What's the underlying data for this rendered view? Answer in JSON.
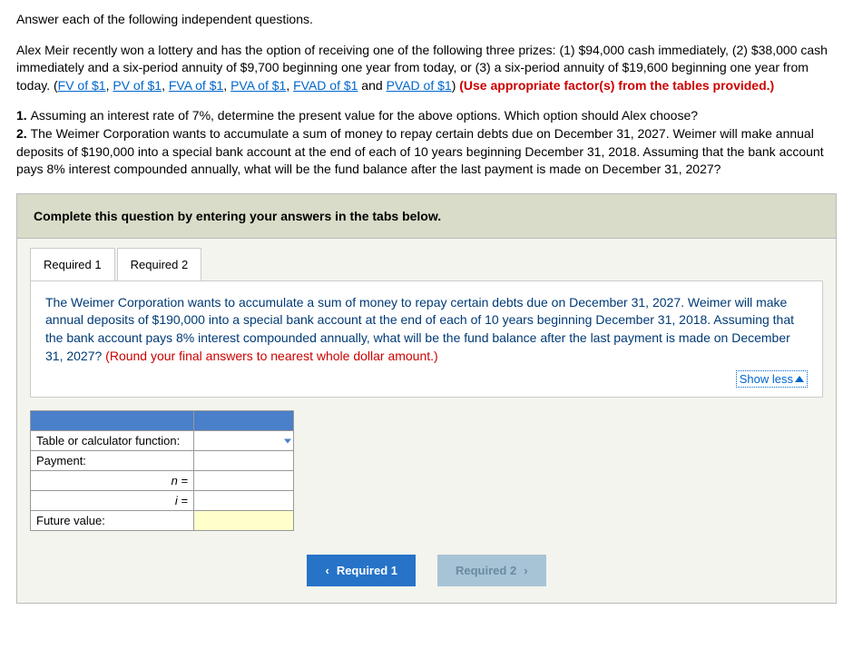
{
  "intro": "Answer each of the following independent questions.",
  "scenario": {
    "part1": "Alex Meir recently won a lottery and has the option of receiving one of the following three prizes: (1) $94,000 cash immediately, (2) $38,000 cash immediately and a six-period annuity of $9,700 beginning one year from today, or (3) a six-period annuity of $19,600 beginning one year from today. (",
    "links": [
      "FV of $1",
      "PV of $1",
      "FVA of $1",
      "PVA of $1",
      "FVAD of $1",
      "PVAD of $1"
    ],
    "and_word": " and ",
    "close_paren": ") ",
    "use_factors": "(Use appropriate factor(s) from the tables provided.)"
  },
  "questions": {
    "q1_prefix": "1. ",
    "q1": "Assuming an interest rate of 7%, determine the present value for the above options. Which option should Alex choose?",
    "q2_prefix": "2. ",
    "q2": "The Weimer Corporation wants to accumulate a sum of money to repay certain debts due on December 31, 2027. Weimer will make annual deposits of $190,000 into a special bank account at the end of each of 10 years beginning December 31, 2018. Assuming that the bank account pays 8% interest compounded annually, what will be the fund balance after the last payment is made on December 31, 2027?"
  },
  "panel": {
    "header": "Complete this question by entering your answers in the tabs below.",
    "tabs": [
      {
        "label": "Required 1"
      },
      {
        "label": "Required 2"
      }
    ],
    "active_question": "The Weimer Corporation wants to accumulate a sum of money to repay certain debts due on December 31, 2027. Weimer will make annual deposits of $190,000 into a special bank account at the end of each of 10 years beginning December 31, 2018. Assuming that the bank account pays 8% interest compounded annually, what will be the fund balance after the last payment is made on December 31, 2027? ",
    "round_hint": "(Round your final answers to nearest whole dollar amount.)",
    "showless": "Show less"
  },
  "table": {
    "rows": [
      {
        "label": "Table or calculator function:",
        "has_dropdown": true,
        "value": ""
      },
      {
        "label": "Payment:",
        "has_dropdown": false,
        "value": ""
      },
      {
        "label": "n =",
        "right": true,
        "has_dropdown": false,
        "value": ""
      },
      {
        "label": "i =",
        "right": true,
        "has_dropdown": false,
        "value": ""
      },
      {
        "label": "Future value:",
        "has_dropdown": false,
        "value": "",
        "yellow": true
      }
    ]
  },
  "nav": {
    "prev": "Required 1",
    "next": "Required 2"
  }
}
